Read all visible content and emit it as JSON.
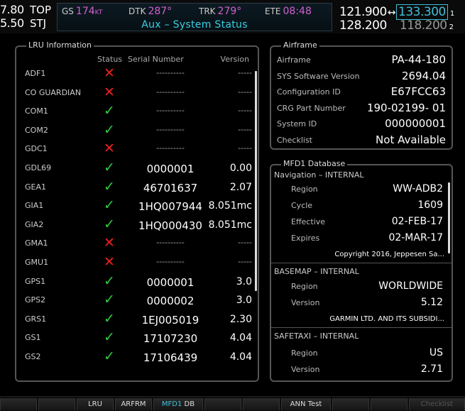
{
  "topbar": {
    "nav1": {
      "freq": "7.80",
      "tag": "TOP"
    },
    "nav2": {
      "freq": "5.50",
      "tag": "STJ"
    },
    "gs": {
      "label": "GS",
      "value": "174",
      "unit": "KT"
    },
    "dtk": {
      "label": "DTK",
      "value": "287°"
    },
    "trk": {
      "label": "TRK",
      "value": "279°"
    },
    "ete": {
      "label": "ETE",
      "value": "08:48"
    },
    "page_title": "Aux – System Status",
    "com1": {
      "active": "121.900",
      "standby": "133.300",
      "index": "1"
    },
    "com2": {
      "active": "128.200",
      "standby": "118.200",
      "index": "2"
    }
  },
  "lru_panel": {
    "title": "LRU Information",
    "headers": {
      "status": "Status",
      "serial": "Serial Number",
      "version": "Version"
    },
    "rows": [
      {
        "name": "ADF1",
        "status": "fail",
        "serial": "----------",
        "version": "-----"
      },
      {
        "name": "CO GUARDIAN",
        "status": "fail",
        "serial": "----------",
        "version": "-----"
      },
      {
        "name": "COM1",
        "status": "ok",
        "serial": "----------",
        "version": "-----"
      },
      {
        "name": "COM2",
        "status": "ok",
        "serial": "----------",
        "version": "-----"
      },
      {
        "name": "GDC1",
        "status": "fail",
        "serial": "----------",
        "version": "-----"
      },
      {
        "name": "GDL69",
        "status": "ok",
        "serial": "0000001",
        "version": "0.00"
      },
      {
        "name": "GEA1",
        "status": "ok",
        "serial": "46701637",
        "version": "2.07"
      },
      {
        "name": "GIA1",
        "status": "ok",
        "serial": "1HQ007944",
        "version": "8.051mc"
      },
      {
        "name": "GIA2",
        "status": "ok",
        "serial": "1HQ000430",
        "version": "8.051mc"
      },
      {
        "name": "GMA1",
        "status": "fail",
        "serial": "----------",
        "version": "-----"
      },
      {
        "name": "GMU1",
        "status": "fail",
        "serial": "----------",
        "version": "-----"
      },
      {
        "name": "GPS1",
        "status": "ok",
        "serial": "0000001",
        "version": "3.0"
      },
      {
        "name": "GPS2",
        "status": "ok",
        "serial": "0000002",
        "version": "3.0"
      },
      {
        "name": "GRS1",
        "status": "ok",
        "serial": "1EJ005019",
        "version": "2.30"
      },
      {
        "name": "GS1",
        "status": "ok",
        "serial": "17107230",
        "version": "4.04"
      },
      {
        "name": "GS2",
        "status": "ok",
        "serial": "17106439",
        "version": "4.04"
      }
    ],
    "status_icons": {
      "ok": "✓",
      "fail": "✕"
    }
  },
  "airframe_panel": {
    "title": "Airframe",
    "rows": [
      {
        "label": "Airframe",
        "value": "PA-44-180"
      },
      {
        "label": "SYS Software Version",
        "value": "2694.04"
      },
      {
        "label": "Configuration ID",
        "value": "E67FCC63"
      },
      {
        "label": "CRG Part Number",
        "value": "190-02199- 01"
      },
      {
        "label": "System ID",
        "value": "000000001"
      },
      {
        "label": "Checklist",
        "value": "Not Available"
      }
    ]
  },
  "mfd_panel": {
    "title": "MFD1 Database",
    "navigation": {
      "header": "Navigation – INTERNAL",
      "rows": [
        {
          "label": "Region",
          "value": "WW-ADB2"
        },
        {
          "label": "Cycle",
          "value": "1609"
        },
        {
          "label": "Effective",
          "value": "02-FEB-17"
        },
        {
          "label": "Expires",
          "value": "02-MAR-17"
        }
      ],
      "note": "Copyright 2016, Jeppesen Sa..."
    },
    "basemap": {
      "header": "BASEMAP – INTERNAL",
      "rows": [
        {
          "label": "Region",
          "value": "WORLDWIDE"
        },
        {
          "label": "Version",
          "value": "5.12"
        }
      ],
      "note": "GARMIN LTD. AND ITS SUBSIDI..."
    },
    "safetaxi": {
      "header": "SAFETAXI – INTERNAL",
      "rows": [
        {
          "label": "Region",
          "value": "US"
        },
        {
          "label": "Version",
          "value": "2.71"
        }
      ]
    }
  },
  "softkeys": {
    "lru": "LRU",
    "arfrm": "ARFRM",
    "mfd1": "MFD1",
    "db": "DB",
    "ann_test": "ANN Test",
    "checklist": "Checklist"
  },
  "colors": {
    "ok": "#2ecc40",
    "fail": "#e82020",
    "cyan": "#3fc0d8",
    "magenta": "#d060d0"
  }
}
